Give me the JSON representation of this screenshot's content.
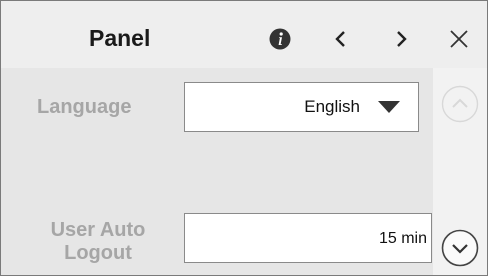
{
  "header": {
    "title": "Panel",
    "icons": [
      "info-icon",
      "chevron-left-icon",
      "chevron-right-icon",
      "close-icon"
    ]
  },
  "settings": {
    "language": {
      "label": "Language",
      "value": "English"
    },
    "user_auto_logout": {
      "label_line1": "User Auto",
      "label_line2": "Logout",
      "value": "15 min"
    }
  },
  "scroll": {
    "icons": [
      "chevron-up-circle-icon",
      "chevron-down-circle-icon"
    ]
  },
  "colors": {
    "panel_bg": "#ececec",
    "label_text": "#a6a6a6",
    "input_bg": "#ffffff"
  }
}
